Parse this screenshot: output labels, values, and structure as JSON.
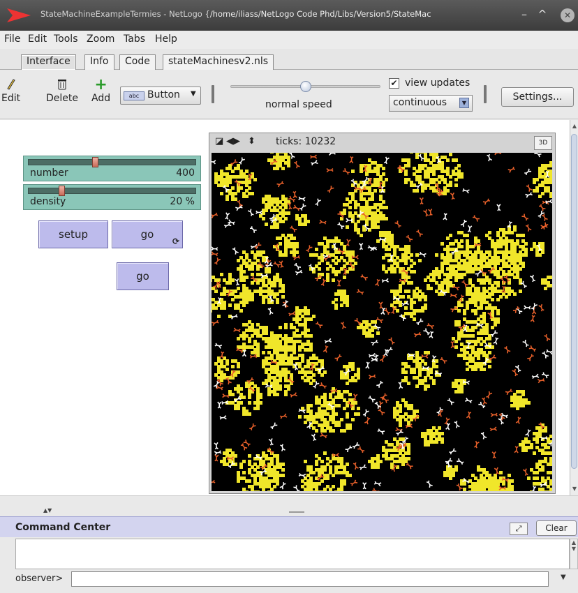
{
  "window": {
    "title_prefix": "StateMachineExampleTermies - NetLogo {",
    "title_path": "/home/iliass/NetLogo Code Phd/Libs/Version5/StateMac",
    "min_icon": "minimize-icon",
    "max_icon": "maximize-icon",
    "close_icon": "close-icon"
  },
  "menu": [
    "File",
    "Edit",
    "Tools",
    "Zoom",
    "Tabs",
    "Help"
  ],
  "tabs": [
    "Interface",
    "Info",
    "Code",
    "stateMachinesv2.nls"
  ],
  "toolbar": {
    "edit": "Edit",
    "delete": "Delete",
    "add": "Add",
    "widget_badge": "abc",
    "widget_type": "Button",
    "speed_label": "normal speed",
    "speed": 0.5,
    "view_updates_label": "view updates",
    "view_updates_checked": true,
    "update_mode": "continuous",
    "settings": "Settings..."
  },
  "widgets": {
    "number_slider": {
      "name": "number",
      "value": "400"
    },
    "density_slider": {
      "name": "density",
      "value": "20 %"
    },
    "setup_button": "setup",
    "go_forever_button": "go",
    "go_button": "go"
  },
  "view": {
    "ticks_label": "ticks: 10232",
    "three_d": "3D",
    "colors": {
      "background": "#000000",
      "patch": "#f0e62a",
      "termite_orange": "#e8602a",
      "termite_white": "#ffffff"
    }
  },
  "command_center": {
    "title": "Command Center",
    "clear": "Clear",
    "prompt": "observer>"
  }
}
